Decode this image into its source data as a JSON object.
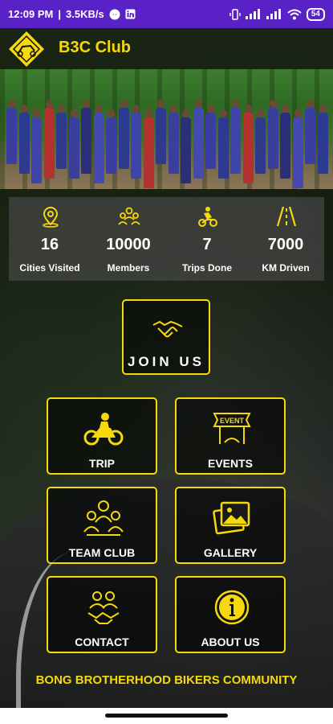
{
  "status_bar": {
    "time": "12:09 PM",
    "speed": "3.5KB/s",
    "battery": "54",
    "icons": [
      "messenger-icon",
      "linkedin-icon",
      "vibrate-icon",
      "signal-icon",
      "signal-icon",
      "wifi-icon",
      "battery-icon"
    ]
  },
  "header": {
    "title": "B3C Club",
    "logo_icon": "b3c-logo"
  },
  "stats": [
    {
      "icon": "location-pin-icon",
      "value": "16",
      "label": "Cities Visited"
    },
    {
      "icon": "group-icon",
      "value": "10000",
      "label": "Members"
    },
    {
      "icon": "rider-icon",
      "value": "7",
      "label": "Trips Done"
    },
    {
      "icon": "road-icon",
      "value": "7000",
      "label": "KM Driven"
    }
  ],
  "join": {
    "label": "JOIN US",
    "icon": "handshake-icon"
  },
  "tiles": [
    {
      "label": "TRIP",
      "icon": "motorbike-icon"
    },
    {
      "label": "EVENTS",
      "icon": "event-banner-icon"
    },
    {
      "label": "TEAM CLUB",
      "icon": "team-icon"
    },
    {
      "label": "GALLERY",
      "icon": "gallery-icon"
    },
    {
      "label": "CONTACT",
      "icon": "contact-handshake-icon"
    },
    {
      "label": "ABOUT US",
      "icon": "info-icon"
    }
  ],
  "footer": {
    "text": "BONG BROTHERHOOD BIKERS COMMUNITY"
  },
  "colors": {
    "accent": "#f5d90a",
    "status_bar": "#5a22c6",
    "text": "#ffffff"
  }
}
